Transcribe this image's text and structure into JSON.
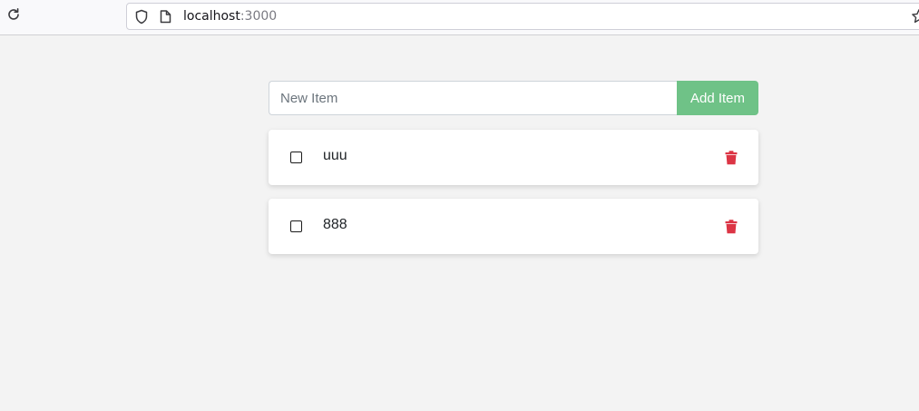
{
  "browser": {
    "url_host": "localhost",
    "url_port": ":3000"
  },
  "form": {
    "input_placeholder": "New Item",
    "add_button_label": "Add Item"
  },
  "todos": [
    {
      "text": "uuu",
      "checked": false
    },
    {
      "text": "888",
      "checked": false
    }
  ],
  "colors": {
    "accent_green": "#6fc287",
    "delete_red": "#dc3545",
    "background": "#f3f3f3"
  },
  "icons": {
    "reload": "reload-icon",
    "shield": "shield-icon",
    "page": "page-icon",
    "bookmark": "star-icon",
    "delete": "trash-icon"
  }
}
